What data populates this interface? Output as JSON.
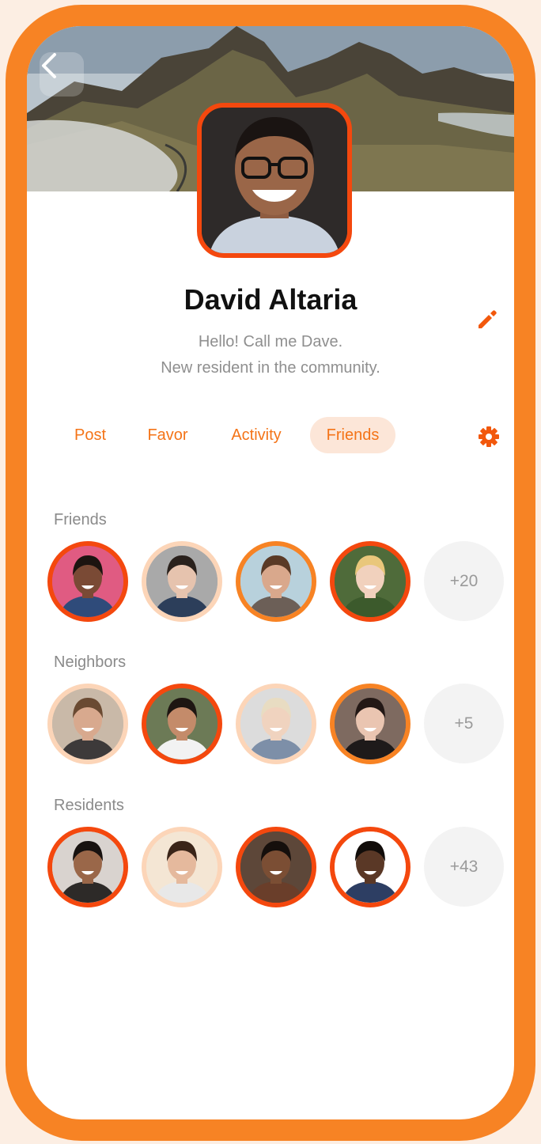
{
  "profile": {
    "name": "David Altaria",
    "bio_line1": "Hello! Call me Dave.",
    "bio_line2": "New resident in the community."
  },
  "tabs": [
    {
      "label": "Post",
      "active": false
    },
    {
      "label": "Favor",
      "active": false
    },
    {
      "label": "Activity",
      "active": false
    },
    {
      "label": "Friends",
      "active": true
    }
  ],
  "icons": {
    "back": "chevron-left-icon",
    "edit": "pencil-icon",
    "settings": "gear-icon"
  },
  "colors": {
    "accent": "#F47418",
    "frame": "#F78324",
    "ring_dark": "#F4480E",
    "ring_mid": "#F78324",
    "ring_light": "#FCD5B8",
    "active_tab_bg": "#FCE6D8"
  },
  "sections": [
    {
      "title": "Friends",
      "more_count": "+20",
      "members": [
        {
          "ring": "dark",
          "bg": "#E05B82",
          "skin": "#7A4A35",
          "hair": "#1C1410",
          "shirt": "#2F4B7A"
        },
        {
          "ring": "light",
          "bg": "#A9A9A9",
          "skin": "#E6C3AE",
          "hair": "#2A211C",
          "shirt": "#2C3E5A"
        },
        {
          "ring": "mid",
          "bg": "#B8D1DC",
          "skin": "#D9A88C",
          "hair": "#5A3A26",
          "shirt": "#6C5F57"
        },
        {
          "ring": "dark",
          "bg": "#4F6B3A",
          "skin": "#F1D1BD",
          "hair": "#E9C77B",
          "shirt": "#3C5A2C"
        }
      ]
    },
    {
      "title": "Neighbors",
      "more_count": "+5",
      "members": [
        {
          "ring": "light",
          "bg": "#C9B9A8",
          "skin": "#D8A98E",
          "hair": "#6A4A32",
          "shirt": "#3D3A3A"
        },
        {
          "ring": "dark",
          "bg": "#6C7A56",
          "skin": "#C48B6A",
          "hair": "#1E1612",
          "shirt": "#F2F2F2"
        },
        {
          "ring": "light",
          "bg": "#DCDCDC",
          "skin": "#F0D3BF",
          "hair": "#E8DCC2",
          "shirt": "#7D8FA8"
        },
        {
          "ring": "mid",
          "bg": "#7E6A60",
          "skin": "#EAC5B1",
          "hair": "#231815",
          "shirt": "#1E1A1A"
        }
      ]
    },
    {
      "title": "Residents",
      "more_count": "+43",
      "members": [
        {
          "ring": "dark",
          "bg": "#D9D3CF",
          "skin": "#9A6749",
          "hair": "#181210",
          "shirt": "#2D2A28"
        },
        {
          "ring": "light",
          "bg": "#F4E6D4",
          "skin": "#E5B99D",
          "hair": "#3A2418",
          "shirt": "#E8E8E8"
        },
        {
          "ring": "dark",
          "bg": "#5D4739",
          "skin": "#7B4E34",
          "hair": "#150F0C",
          "shirt": "#6A3E2A"
        },
        {
          "ring": "dark",
          "bg": "#FFFFFF",
          "skin": "#5A3826",
          "hair": "#120D0A",
          "shirt": "#2D3E63"
        }
      ]
    }
  ]
}
